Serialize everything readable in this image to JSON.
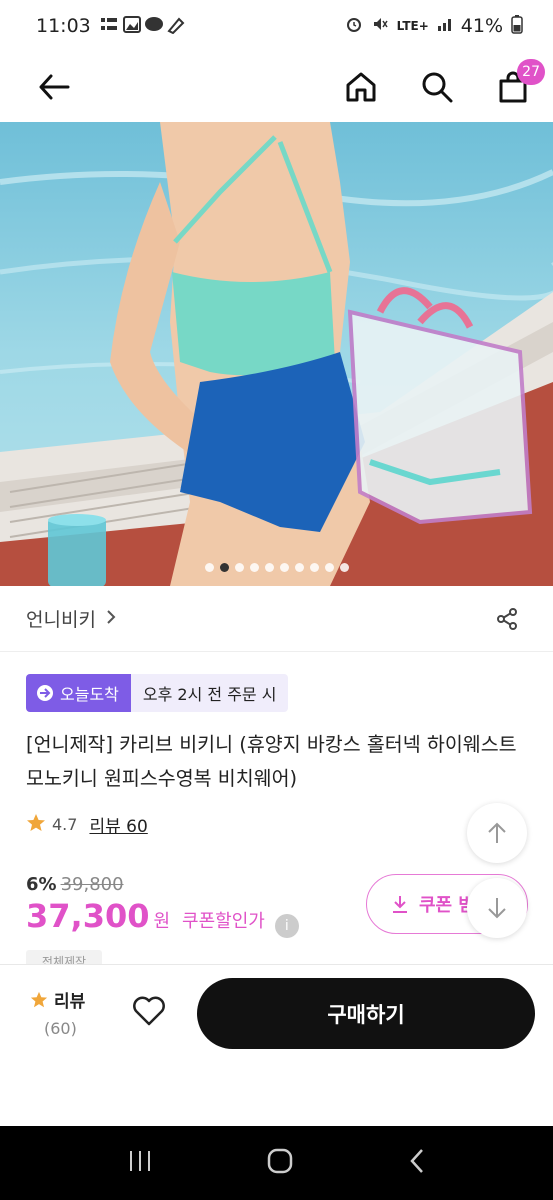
{
  "status_bar": {
    "time": "11:03",
    "network": "LTE+",
    "battery": "41%"
  },
  "header": {
    "cart_count": "27"
  },
  "image_carousel": {
    "total": 10,
    "active_index": 1
  },
  "brand": {
    "name": "언니비키",
    "chevron": ">"
  },
  "delivery": {
    "badge": "오늘도착",
    "text": "오후 2시 전 주문 시"
  },
  "product": {
    "title": "[언니제작] 카리브 비키니 (휴양지 바캉스 홀터넥 하이웨스트 모노키니 원피스수영복 비치웨어)",
    "rating": "4.7",
    "review_link": "리뷰 60",
    "discount": "6%",
    "original_price": "39,800",
    "price": "37,300",
    "currency": "원",
    "coupon_discount_label": "쿠폰할인가",
    "info_icon": "i"
  },
  "coupon_button": {
    "label": "쿠폰 받"
  },
  "option_chip": {
    "label": "전체제작"
  },
  "bottom_bar": {
    "review_label": "리뷰",
    "review_count": "(60)",
    "buy_label": "구매하기"
  },
  "colors": {
    "accent_pink": "#e052c8",
    "delivery_purple": "#7e5ce6",
    "buy_button": "#111111"
  }
}
